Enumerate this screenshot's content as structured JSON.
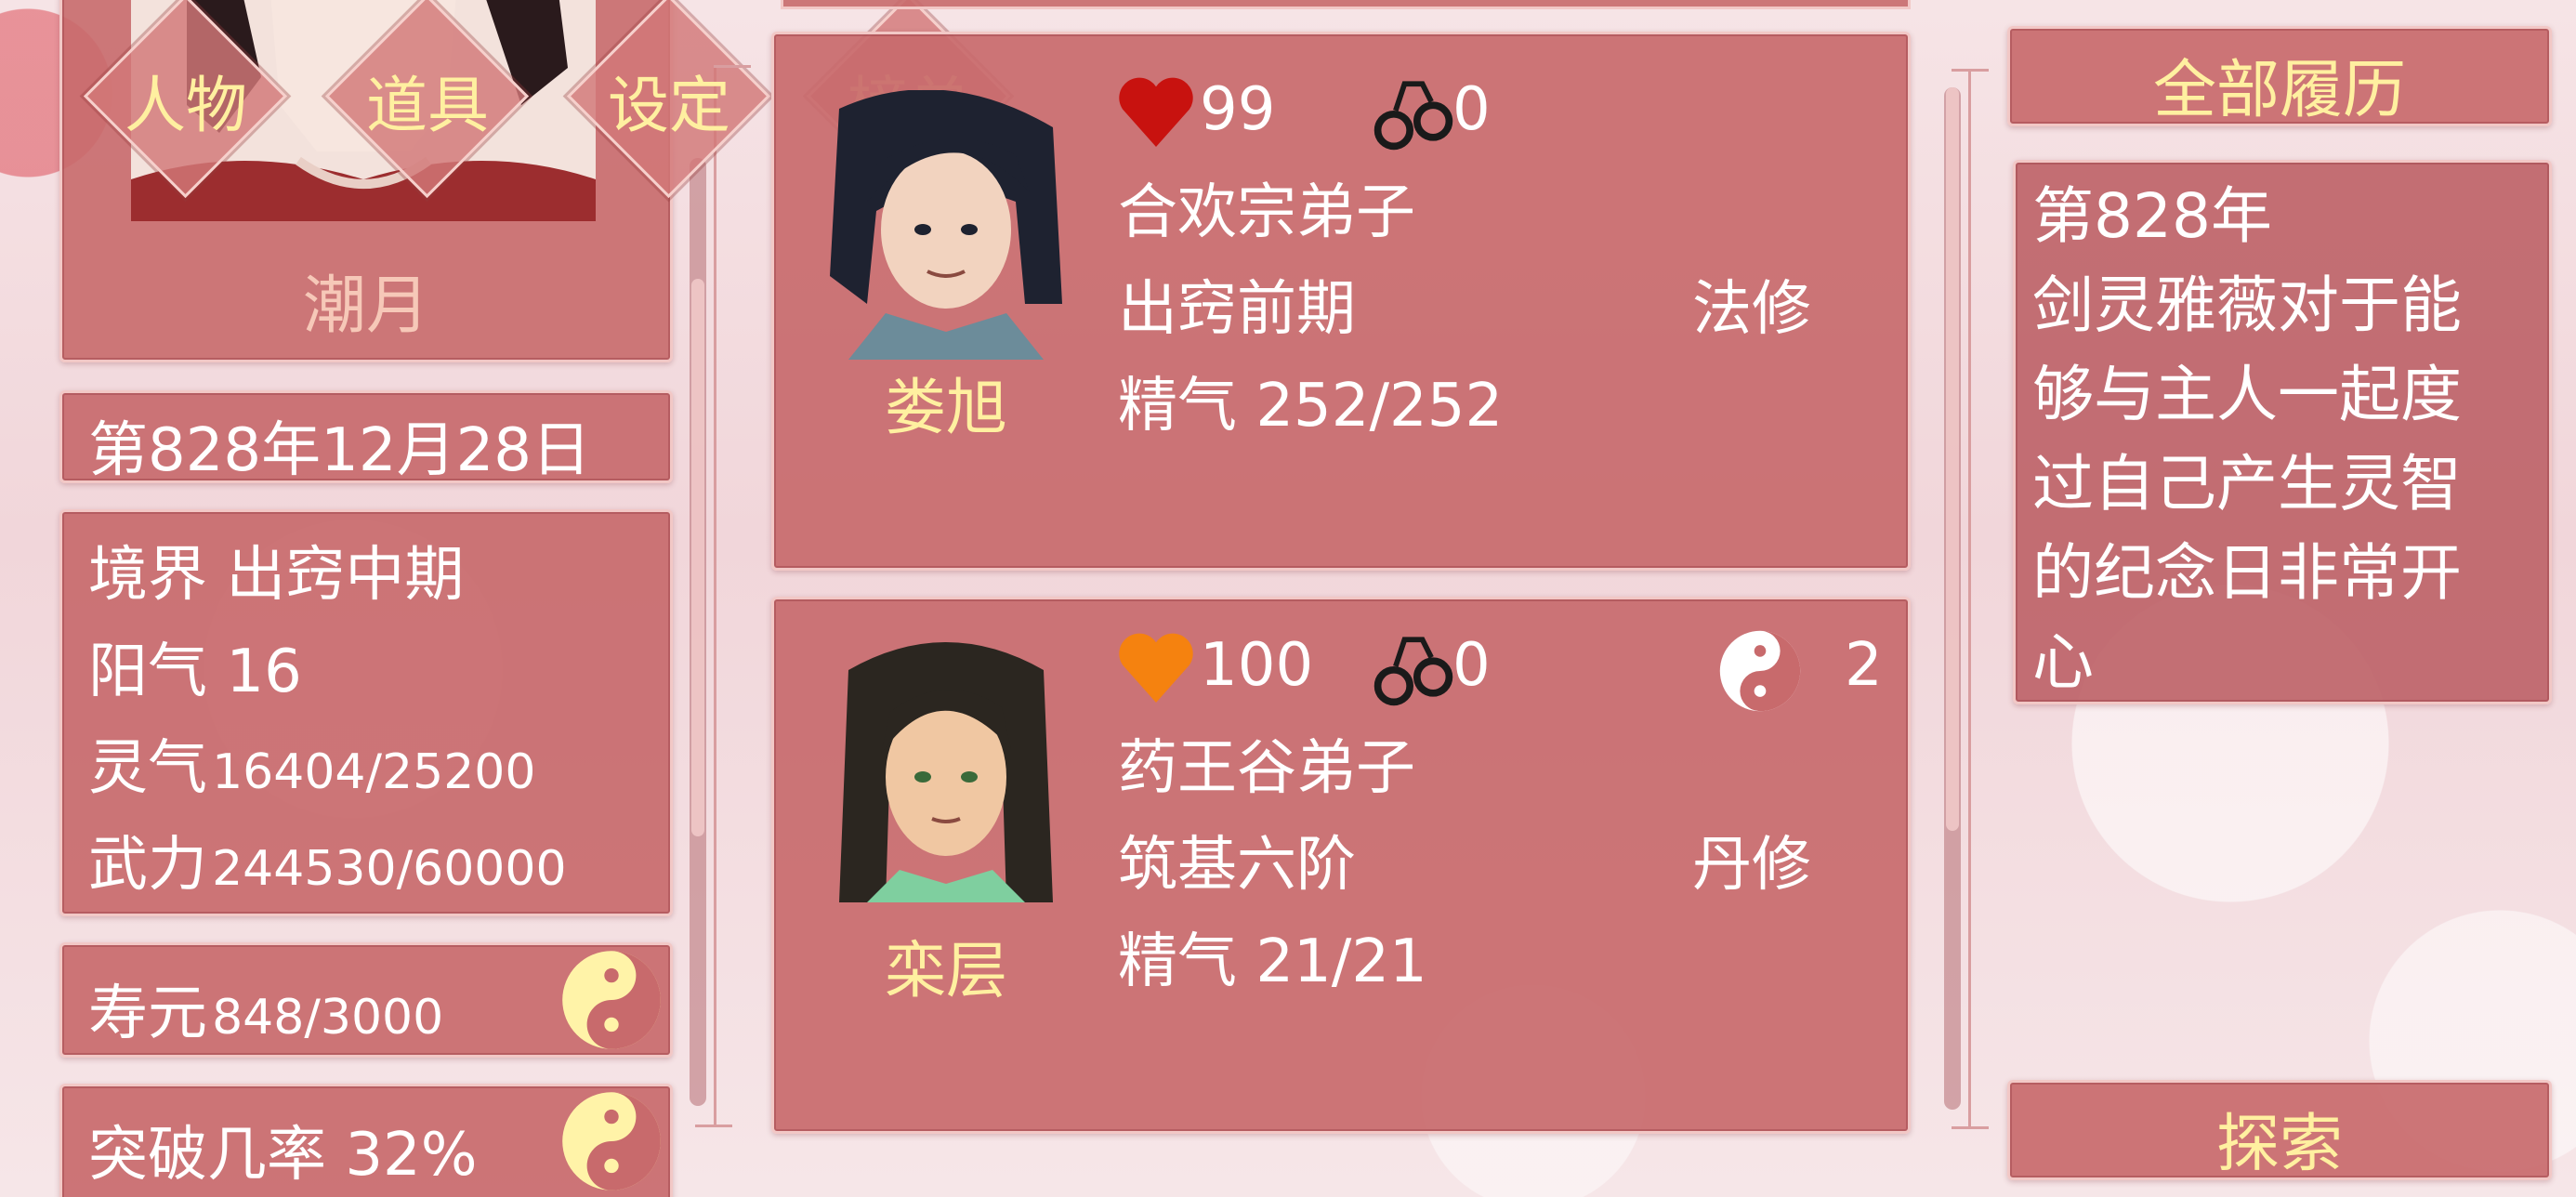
{
  "nav": {
    "tabs": [
      {
        "label": "人物"
      },
      {
        "label": "道具"
      },
      {
        "label": "设定"
      },
      {
        "label": "榜单"
      }
    ]
  },
  "player": {
    "name": "潮月",
    "date": "第828年12月28日",
    "realm_label": "境界",
    "realm_value": "出窍中期",
    "yang_label": "阳气",
    "yang_value": "16",
    "spirit_label": "灵气",
    "spirit_value": "16404/25200",
    "power_label": "武力",
    "power_value": "244530/60000",
    "lifespan_label": "寿元",
    "lifespan_value": "848/3000",
    "breakthrough": "突破几率 32%"
  },
  "characters": [
    {
      "name": "娄旭",
      "heart_color": "#c8120f",
      "affection": "99",
      "bond": "0",
      "sect": "合欢宗弟子",
      "realm": "出窍前期",
      "path": "法修",
      "essence": "精气 252/252",
      "dual_count": ""
    },
    {
      "name": "栾层",
      "heart_color": "#f5820f",
      "affection": "100",
      "bond": "0",
      "sect": "药王谷弟子",
      "realm": "筑基六阶",
      "path": "丹修",
      "essence": "精气 21/21",
      "dual_count": "2"
    }
  ],
  "history": {
    "button_label": "全部履历",
    "text": "第828年\n剑灵雅薇对于能\n够与主人一起度\n过自己产生灵智\n的纪念日非常开\n心"
  },
  "explore": {
    "button_label": "探索"
  }
}
